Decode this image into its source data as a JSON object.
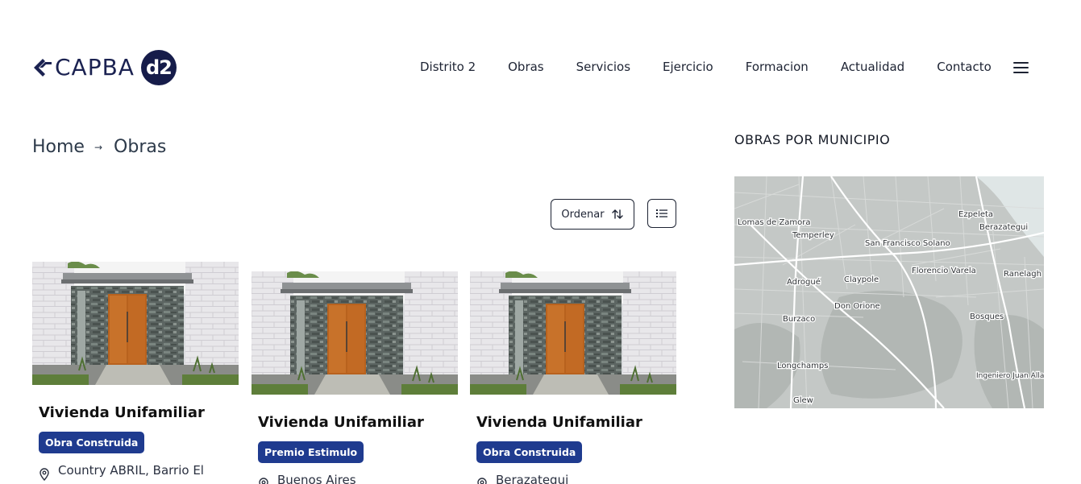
{
  "header": {
    "logo_text": "CAPBA",
    "logo_badge": "d2",
    "nav": [
      "Distrito 2",
      "Obras",
      "Servicios",
      "Ejercicio",
      "Formacion",
      "Actualidad",
      "Contacto"
    ]
  },
  "breadcrumb": {
    "home": "Home",
    "separator": "→",
    "current": "Obras"
  },
  "toolbar": {
    "sort_label": "Ordenar"
  },
  "cards": [
    {
      "title": "Vivienda Unifamiliar",
      "badge": "Obra Construida",
      "location": "Country ABRIL, Barrio El"
    },
    {
      "title": "Vivienda Unifamiliar",
      "badge": "Premio Estimulo",
      "location": "Buenos Aires"
    },
    {
      "title": "Vivienda Unifamiliar",
      "badge": "Obra Construida",
      "location": "Berazategui"
    }
  ],
  "sidebar": {
    "title": "OBRAS POR MUNICIPIO",
    "map_labels": [
      "Lomas de Zamora",
      "Temperley",
      "San Francisco Solano",
      "Ezpeleta",
      "Berazategui",
      "Florencio Varela",
      "Ranelagh",
      "Adrogué",
      "Claypole",
      "Don Orione",
      "Burzaco",
      "Bosques",
      "Longchamps",
      "Ingeniero Juan Allan",
      "Glew"
    ]
  },
  "colors": {
    "brand_navy": "#161c4a",
    "badge_blue": "#1f3b8f",
    "map_land": "#c4c8c6",
    "map_water": "#dfe6e6"
  }
}
